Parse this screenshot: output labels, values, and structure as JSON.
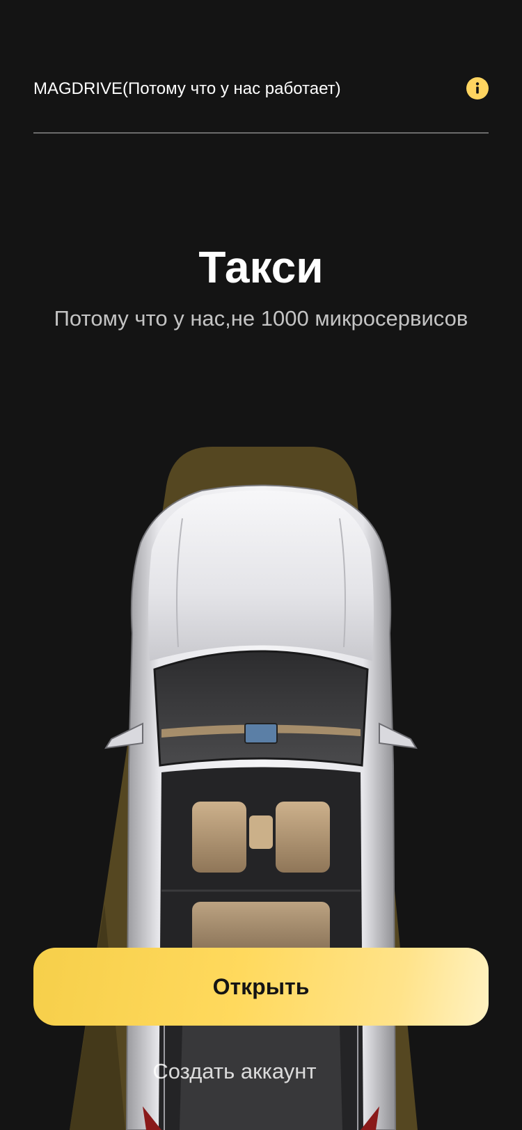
{
  "header": {
    "app_title": "MAGDRIVE(Потому что у нас работает)",
    "info_icon": "info-icon"
  },
  "hero": {
    "title": "Такси",
    "subtitle": "Потому что у нас,не 1000 микросервисов"
  },
  "actions": {
    "open_label": "Открыть",
    "create_account_label": "Создать аккаунт"
  },
  "colors": {
    "background": "#141414",
    "accent": "#ffd560",
    "headlight_glow": "#5c4d22",
    "divider": "#6b6b6b",
    "subtitle": "#c4c4c4"
  }
}
